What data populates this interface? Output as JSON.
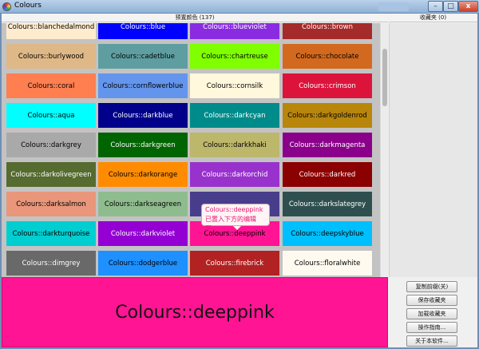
{
  "window": {
    "title": "Colours",
    "min_glyph": "–",
    "max_glyph": "□",
    "close_glyph": "x"
  },
  "header": {
    "preset_title": "预置颜色 (137)",
    "favorites_title": "收藏夹 (0)"
  },
  "swatches": [
    {
      "label": "Colours::blanchedalmond",
      "bg": "#ffebcd",
      "fg": "#000000"
    },
    {
      "label": "Colours::blue",
      "bg": "#0000ff",
      "fg": "#ffffff"
    },
    {
      "label": "Colours::blueviolet",
      "bg": "#8a2be2",
      "fg": "#ffffff"
    },
    {
      "label": "Colours::brown",
      "bg": "#a52a2a",
      "fg": "#ffffff"
    },
    {
      "label": "Colours::burlywood",
      "bg": "#deb887",
      "fg": "#000000"
    },
    {
      "label": "Colours::cadetblue",
      "bg": "#5f9ea0",
      "fg": "#000000"
    },
    {
      "label": "Colours::chartreuse",
      "bg": "#7fff00",
      "fg": "#000000"
    },
    {
      "label": "Colours::chocolate",
      "bg": "#d2691e",
      "fg": "#000000"
    },
    {
      "label": "Colours::coral",
      "bg": "#ff7f50",
      "fg": "#000000"
    },
    {
      "label": "Colours::cornflowerblue",
      "bg": "#6495ed",
      "fg": "#000000"
    },
    {
      "label": "Colours::cornsilk",
      "bg": "#fff8dc",
      "fg": "#000000"
    },
    {
      "label": "Colours::crimson",
      "bg": "#dc143c",
      "fg": "#ffffff"
    },
    {
      "label": "Colours::aqua",
      "bg": "#00ffff",
      "fg": "#000000"
    },
    {
      "label": "Colours::darkblue",
      "bg": "#00008b",
      "fg": "#ffffff"
    },
    {
      "label": "Colours::darkcyan",
      "bg": "#008b8b",
      "fg": "#ffffff"
    },
    {
      "label": "Colours::darkgoldenrod",
      "bg": "#b8860b",
      "fg": "#000000"
    },
    {
      "label": "Colours::darkgrey",
      "bg": "#a9a9a9",
      "fg": "#000000"
    },
    {
      "label": "Colours::darkgreen",
      "bg": "#006400",
      "fg": "#ffffff"
    },
    {
      "label": "Colours::darkkhaki",
      "bg": "#bdb76b",
      "fg": "#000000"
    },
    {
      "label": "Colours::darkmagenta",
      "bg": "#8b008b",
      "fg": "#ffffff"
    },
    {
      "label": "Colours::darkolivegreen",
      "bg": "#556b2f",
      "fg": "#ffffff"
    },
    {
      "label": "Colours::darkorange",
      "bg": "#ff8c00",
      "fg": "#000000"
    },
    {
      "label": "Colours::darkorchid",
      "bg": "#9932cc",
      "fg": "#ffffff"
    },
    {
      "label": "Colours::darkred",
      "bg": "#8b0000",
      "fg": "#ffffff"
    },
    {
      "label": "Colours::darksalmon",
      "bg": "#e9967a",
      "fg": "#000000"
    },
    {
      "label": "Colours::darkseagreen",
      "bg": "#8fbc8f",
      "fg": "#000000"
    },
    {
      "label": "",
      "bg": "#483d8b",
      "fg": "#ffffff"
    },
    {
      "label": "Colours::darkslategrey",
      "bg": "#2f4f4f",
      "fg": "#ffffff"
    },
    {
      "label": "Colours::darkturquoise",
      "bg": "#00ced1",
      "fg": "#000000"
    },
    {
      "label": "Colours::darkviolet",
      "bg": "#9400d3",
      "fg": "#ffffff"
    },
    {
      "label": "Colours::deeppink",
      "bg": "#ff1493",
      "fg": "#000000"
    },
    {
      "label": "Colours::deepskyblue",
      "bg": "#00bfff",
      "fg": "#000000"
    },
    {
      "label": "Colours::dimgrey",
      "bg": "#696969",
      "fg": "#ffffff"
    },
    {
      "label": "Colours::dodgerblue",
      "bg": "#1e90ff",
      "fg": "#000000"
    },
    {
      "label": "Colours::firebrick",
      "bg": "#b22222",
      "fg": "#ffffff"
    },
    {
      "label": "Colours::floralwhite",
      "bg": "#fffaf0",
      "fg": "#000000"
    },
    {
      "label": "",
      "bg": "#228b22",
      "fg": "#ffffff"
    },
    {
      "label": "",
      "bg": "#ff00ff",
      "fg": "#ffffff"
    },
    {
      "label": "",
      "bg": "#dcdcdc",
      "fg": "#000000"
    },
    {
      "label": "",
      "bg": "#f8f8ff",
      "fg": "#000000"
    }
  ],
  "tooltip": {
    "line1": "Colours::deeppink",
    "line2": "已置入下方的编辑区。"
  },
  "preview": {
    "text": "Colours::deeppink",
    "color": "#ff1493"
  },
  "buttons": {
    "copy": "复制前缀(关)",
    "save": "保存收藏夹",
    "load": "加载收藏夹",
    "guide": "操作指南...",
    "about": "关于本软件..."
  }
}
